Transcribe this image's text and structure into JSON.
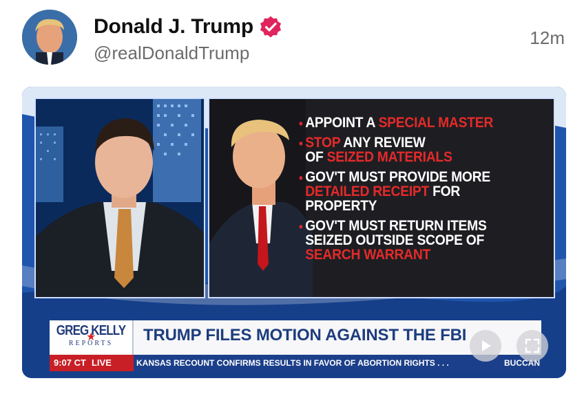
{
  "post": {
    "display_name": "Donald J. Trump",
    "handle": "@realDonaldTrump",
    "timestamp": "12m",
    "verified_icon": "verified-badge-icon",
    "accent_color": "#e0245e"
  },
  "video": {
    "panel": {
      "bullets": [
        {
          "segments": [
            {
              "text": "APPOINT A ",
              "hl": false
            },
            {
              "text": "SPECIAL MASTER",
              "hl": true
            }
          ]
        },
        {
          "segments": [
            {
              "text": "STOP",
              "hl": true
            },
            {
              "text": " ANY REVIEW",
              "hl": false
            }
          ],
          "line2": [
            {
              "text": "OF ",
              "hl": false
            },
            {
              "text": "SEIZED MATERIALS",
              "hl": true
            }
          ]
        },
        {
          "segments": [
            {
              "text": "GOV'T MUST PROVIDE MORE",
              "hl": false
            }
          ],
          "line2": [
            {
              "text": "DETAILED RECEIPT",
              "hl": true
            },
            {
              "text": " FOR PROPERTY",
              "hl": false
            }
          ]
        },
        {
          "segments": [
            {
              "text": "GOV'T MUST RETURN ITEMS",
              "hl": false
            }
          ],
          "line2": [
            {
              "text": "SEIZED OUTSIDE SCOPE OF",
              "hl": false
            }
          ],
          "line3": [
            {
              "text": "SEARCH WARRANT",
              "hl": true
            }
          ]
        }
      ]
    },
    "lower_third": {
      "show_logo_main": "GREG KELLY",
      "show_logo_sub": "REPORTS",
      "headline": "TRUMP FILES MOTION AGAINST THE FBI",
      "clock": "9:07 CT",
      "live_label": "LIVE",
      "ticker": "KANSAS RECOUNT CONFIRMS RESULTS IN FAVOR OF ABORTION RIGHTS . . .",
      "ticker_tag": "BUCCAN"
    },
    "controls": {
      "play_icon": "play-icon",
      "fullscreen_icon": "fullscreen-icon"
    },
    "colors": {
      "network_blue": "#1b3f8a",
      "headline_blue": "#1d3d7d",
      "alert_red": "#c81f26",
      "highlight_red": "#e42a2a"
    }
  }
}
